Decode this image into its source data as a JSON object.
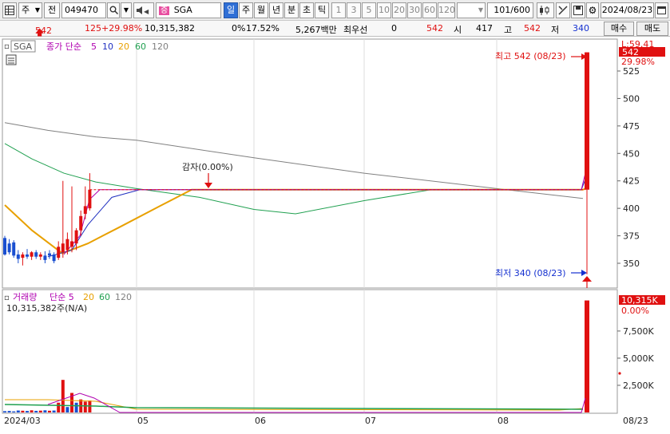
{
  "toolbar": {
    "dropdown_icon": "grid-icon",
    "market_select": "주",
    "prev_label": "전",
    "stock_code": "049470",
    "stock_name_badge": "증",
    "stock_name": "SGA",
    "periods": [
      "일",
      "주",
      "월",
      "년",
      "분",
      "초",
      "틱"
    ],
    "active_period": "일",
    "intervals": [
      "1",
      "3",
      "5",
      "10",
      "20",
      "30",
      "60",
      "120"
    ],
    "count": "101",
    "count_total": "/600",
    "date": "2024/08/23"
  },
  "infobar": {
    "price": "542",
    "change": "125",
    "change_pct": "+29.98%",
    "volume": "10,315,382",
    "turnover": "0%",
    "turnover_pct": "17.52%",
    "amount": "5,267백만",
    "priority_label": "최우선",
    "priority_value": "0",
    "priority_price": "542",
    "open_label": "시",
    "open_value": "417",
    "high_label": "고",
    "high_value": "542",
    "low_label": "저",
    "low_value": "340",
    "buy_label": "매수",
    "sell_label": "매도"
  },
  "price_panel": {
    "symbol": "SGA",
    "legend_title": "종가 단순",
    "ma_periods": [
      "5",
      "10",
      "20",
      "60",
      "120"
    ],
    "ma_colors": [
      "#b000b0",
      "#2030c0",
      "#e8a000",
      "#20a050",
      "#808080"
    ],
    "high_annotation": "최고 542 (08/23)",
    "low_annotation": "최저 340 (08/23)",
    "capital_reduction": "감자(0.00%)",
    "axis_label_top": "L:59.41",
    "price_tag": "542",
    "pct_tag": "29.98%"
  },
  "volume_panel": {
    "legend_title": "거래량",
    "legend_ma": "단순 5",
    "ma_periods": [
      "20",
      "60",
      "120"
    ],
    "volume_info": "10,315,382주(N/A)",
    "volume_tag": "10,315K",
    "pct_tag": "0.00%"
  },
  "x_axis": {
    "labels": [
      "2024/03",
      "05",
      "06",
      "07",
      "08",
      "08/23"
    ]
  },
  "chart_data": {
    "type": "candlestick",
    "price_axis": {
      "ylim": [
        328,
        565
      ],
      "ticks": [
        350,
        375,
        400,
        425,
        450,
        475,
        500,
        525
      ]
    },
    "volume_axis": {
      "ylim": [
        0,
        10800000
      ],
      "ticks": [
        "2,500K",
        "5,000K",
        "7,500K"
      ],
      "tick_values": [
        2500000,
        5000000,
        7500000
      ]
    },
    "candles": [
      {
        "o": 373,
        "h": 375,
        "l": 357,
        "c": 358
      },
      {
        "o": 368,
        "h": 372,
        "l": 358,
        "c": 360
      },
      {
        "o": 369,
        "h": 371,
        "l": 355,
        "c": 357
      },
      {
        "o": 358,
        "h": 362,
        "l": 350,
        "c": 354
      },
      {
        "o": 355,
        "h": 360,
        "l": 348,
        "c": 358
      },
      {
        "o": 358,
        "h": 363,
        "l": 354,
        "c": 356
      },
      {
        "o": 356,
        "h": 361,
        "l": 353,
        "c": 360
      },
      {
        "o": 360,
        "h": 362,
        "l": 354,
        "c": 356
      },
      {
        "o": 356,
        "h": 360,
        "l": 353,
        "c": 358
      },
      {
        "o": 357,
        "h": 361,
        "l": 350,
        "c": 353
      },
      {
        "o": 359,
        "h": 362,
        "l": 354,
        "c": 357
      },
      {
        "o": 358,
        "h": 360,
        "l": 350,
        "c": 352
      },
      {
        "o": 355,
        "h": 370,
        "l": 353,
        "c": 365
      },
      {
        "o": 360,
        "h": 425,
        "l": 355,
        "c": 368
      },
      {
        "o": 362,
        "h": 378,
        "l": 358,
        "c": 372
      },
      {
        "o": 365,
        "h": 420,
        "l": 360,
        "c": 370
      },
      {
        "o": 368,
        "h": 382,
        "l": 362,
        "c": 380
      },
      {
        "o": 380,
        "h": 398,
        "l": 375,
        "c": 393
      },
      {
        "o": 395,
        "h": 420,
        "l": 390,
        "c": 402
      },
      {
        "o": 400,
        "h": 432,
        "l": 398,
        "c": 417
      }
    ],
    "flat_price": 417,
    "last_day": {
      "o": 417,
      "h": 542,
      "l": 340,
      "c": 542
    },
    "volumes": [
      {
        "v": 120000,
        "up": false
      },
      {
        "v": 140000,
        "up": false
      },
      {
        "v": 100000,
        "up": false
      },
      {
        "v": 180000,
        "up": false
      },
      {
        "v": 160000,
        "up": true
      },
      {
        "v": 140000,
        "up": false
      },
      {
        "v": 200000,
        "up": true
      },
      {
        "v": 150000,
        "up": false
      },
      {
        "v": 170000,
        "up": true
      },
      {
        "v": 200000,
        "up": false
      },
      {
        "v": 160000,
        "up": true
      },
      {
        "v": 180000,
        "up": false
      },
      {
        "v": 900000,
        "up": true
      },
      {
        "v": 3000000,
        "up": true
      },
      {
        "v": 500000,
        "up": false
      },
      {
        "v": 1800000,
        "up": true
      },
      {
        "v": 900000,
        "up": false
      },
      {
        "v": 1200000,
        "up": true
      },
      {
        "v": 1000000,
        "up": true
      },
      {
        "v": 1100000,
        "up": true
      }
    ],
    "last_volume": 10315382
  }
}
